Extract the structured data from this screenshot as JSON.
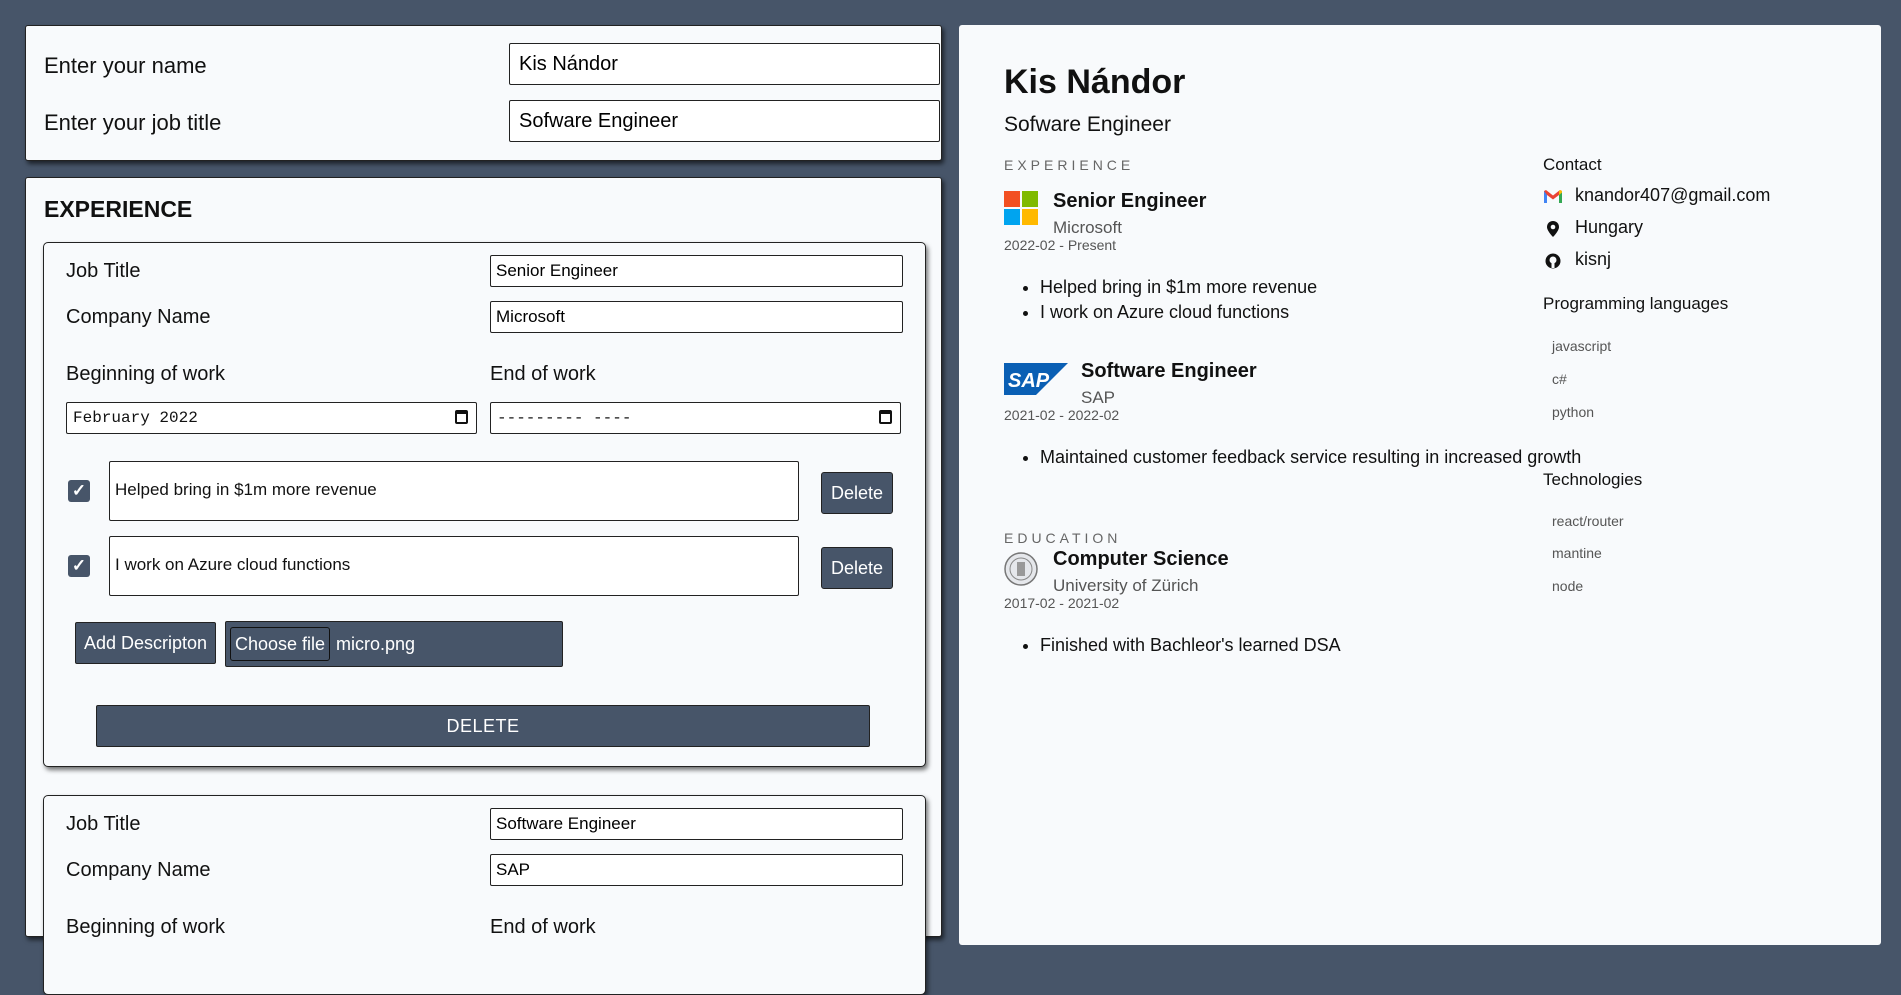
{
  "form": {
    "name_label": "Enter your name",
    "name_value": "Kis Nándor",
    "job_label": "Enter your job title",
    "job_value": "Sofware Engineer"
  },
  "experience_editor": {
    "title": "EXPERIENCE",
    "job_title_label": "Job Title",
    "company_label": "Company Name",
    "begin_label": "Beginning of work",
    "end_label": "End of work",
    "delete_label": "Delete",
    "add_description_label": "Add Descripton",
    "choose_file_label": "Choose file",
    "delete_entry_label": "DELETE",
    "entries": [
      {
        "job_title": "Senior Engineer",
        "company": "Microsoft",
        "begin": "February 2022",
        "end": "--------- ----",
        "descriptions": [
          "Helped bring in $1m more revenue",
          "I work on Azure cloud functions"
        ],
        "file_name": "micro.png"
      },
      {
        "job_title": "Software Engineer",
        "company": "SAP"
      }
    ]
  },
  "preview": {
    "name": "Kis Nándor",
    "title": "Sofware Engineer",
    "experience_heading": "EXPERIENCE",
    "education_heading": "EDUCATION",
    "experience": [
      {
        "title": "Senior Engineer",
        "company": "Microsoft",
        "dates": "2022-02 - Present",
        "bullets": [
          "Helped bring in $1m more revenue",
          "I work on Azure cloud functions"
        ],
        "logo": "microsoft-logo"
      },
      {
        "title": "Software Engineer",
        "company": "SAP",
        "dates": "2021-02 - 2022-02",
        "bullets": [
          "Maintained customer feedback service resulting in increased growth"
        ],
        "logo": "sap-logo"
      }
    ],
    "education": {
      "title": "Computer Science",
      "school": "University of Zürich",
      "dates": "2017-02 - 2021-02",
      "bullets": [
        "Finished with Bachleor's learned DSA"
      ],
      "logo": "university-seal"
    },
    "sidebar": {
      "contact_heading": "Contact",
      "email": "knandor407@gmail.com",
      "location": "Hungary",
      "github": "kisnj",
      "languages_heading": "Programming languages",
      "languages": [
        "javascript",
        "c#",
        "python"
      ],
      "technologies_heading": "Technologies",
      "technologies": [
        "react/router",
        "mantine",
        "node"
      ]
    }
  },
  "colors": {
    "background": "#475569",
    "panel": "#f8fafc",
    "button": "#475569"
  }
}
